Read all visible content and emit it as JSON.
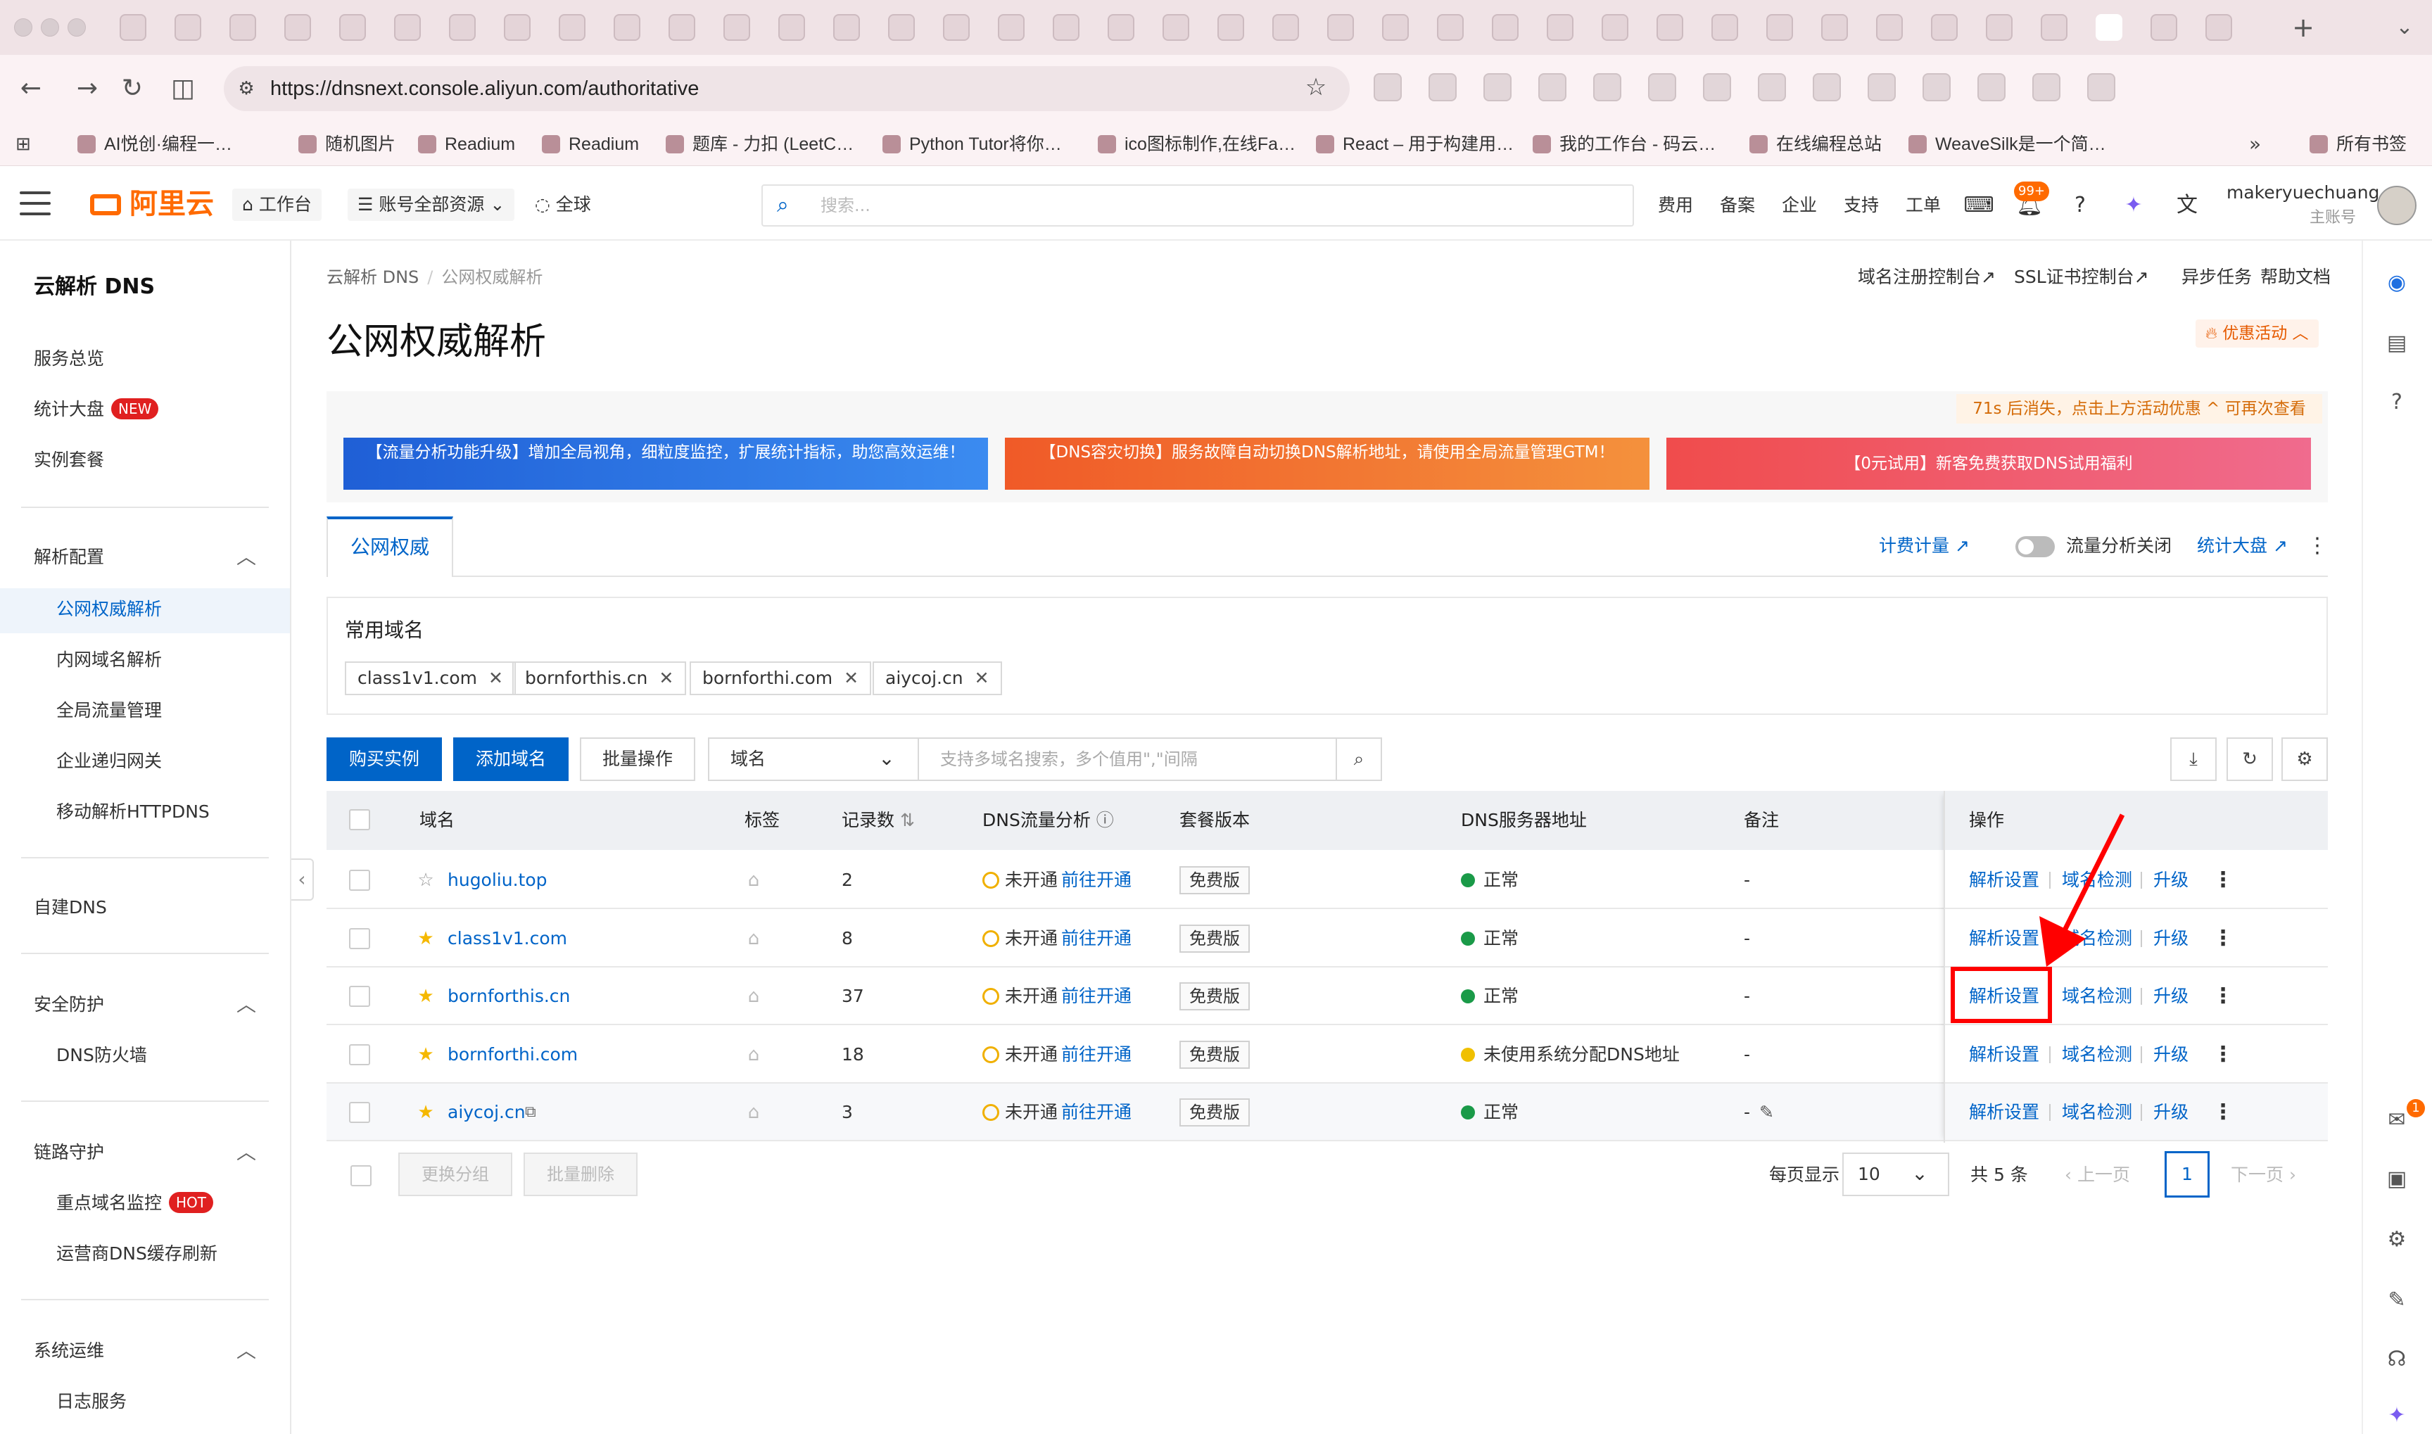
{
  "browser": {
    "url": "https://dnsnext.console.aliyun.com/authoritative",
    "bookmarks": [
      "AI悦创·编程一…",
      "随机图片",
      "Readium",
      "Readium",
      "题库 - 力扣 (LeetC…",
      "Python Tutor将你…",
      "ico图标制作,在线Fa…",
      "React – 用于构建用…",
      "我的工作台 - 码云…",
      "在线编程总站",
      "WeaveSilk是一个简…",
      "所有书签"
    ]
  },
  "topbar": {
    "logo": "阿里云",
    "workbench": "工作台",
    "resources": "账号全部资源",
    "region": "全球",
    "search_placeholder": "搜索...",
    "nav": [
      "费用",
      "备案",
      "企业",
      "支持",
      "工单"
    ],
    "notification_badge": "99+",
    "username": "makeryuechuang",
    "user_role": "主账号"
  },
  "sidebar": {
    "title": "云解析 DNS",
    "items": {
      "overview": "服务总览",
      "dashboard": "统计大盘",
      "dashboard_badge": "NEW",
      "instances": "实例套餐",
      "config_group": "解析配置",
      "authoritative": "公网权威解析",
      "intranet": "内网域名解析",
      "gtm": "全局流量管理",
      "recursive": "企业递归网关",
      "httpdns": "移动解析HTTPDNS",
      "self_dns": "自建DNS",
      "security_group": "安全防护",
      "firewall": "DNS防火墙",
      "link_group": "链路守护",
      "monitor": "重点域名监控",
      "monitor_badge": "HOT",
      "cache_refresh": "运营商DNS缓存刷新",
      "ops_group": "系统运维",
      "logs": "日志服务"
    }
  },
  "main": {
    "breadcrumb": [
      "云解析 DNS",
      "公网权威解析"
    ],
    "title": "公网权威解析",
    "top_links": [
      "域名注册控制台",
      "SSL证书控制台",
      "异步任务",
      "帮助文档"
    ],
    "promo": "优惠活动",
    "banner_tip": "71s 后消失，点击上方活动优惠 ^ 可再次查看",
    "banners": [
      "【流量分析功能升级】增加全局视角，细粒度监控，扩展统计指标，助您高效运维！",
      "【DNS容灾切换】服务故障自动切换DNS解析地址，请使用全局流量管理GTM！",
      "【0元试用】新客免费获取DNS试用福利"
    ],
    "tab": "公网权威",
    "tab_links": {
      "billing": "计费计量",
      "traffic_toggle": "流量分析关闭",
      "stats": "统计大盘"
    },
    "common_domains": {
      "title": "常用域名",
      "chips": [
        "class1v1.com",
        "bornforthis.cn",
        "bornforthi.com",
        "aiycoj.cn"
      ]
    },
    "actions": {
      "buy": "购买实例",
      "add": "添加域名",
      "batch": "批量操作",
      "filter_field": "域名",
      "filter_placeholder": "支持多域名搜索，多个值用\",\"间隔"
    },
    "table": {
      "headers": [
        "域名",
        "标签",
        "记录数",
        "DNS流量分析",
        "套餐版本",
        "DNS服务器地址",
        "备注",
        "操作"
      ],
      "rows": [
        {
          "domain": "hugoliu.top",
          "starred": false,
          "records": "2",
          "traffic": "未开通",
          "traffic_link": "前往开通",
          "plan": "免费版",
          "dns_status": "正常",
          "dns_ok": true,
          "note": "-",
          "ops": [
            "解析设置",
            "域名检测",
            "升级"
          ]
        },
        {
          "domain": "class1v1.com",
          "starred": true,
          "records": "8",
          "traffic": "未开通",
          "traffic_link": "前往开通",
          "plan": "免费版",
          "dns_status": "正常",
          "dns_ok": true,
          "note": "-",
          "ops": [
            "解析设置",
            "域名检测",
            "升级"
          ]
        },
        {
          "domain": "bornforthis.cn",
          "starred": true,
          "records": "37",
          "traffic": "未开通",
          "traffic_link": "前往开通",
          "plan": "免费版",
          "dns_status": "正常",
          "dns_ok": true,
          "note": "-",
          "ops": [
            "解析设置",
            "域名检测",
            "升级"
          ]
        },
        {
          "domain": "bornforthi.com",
          "starred": true,
          "records": "18",
          "traffic": "未开通",
          "traffic_link": "前往开通",
          "plan": "免费版",
          "dns_status": "未使用系统分配DNS地址",
          "dns_ok": false,
          "note": "-",
          "ops": [
            "解析设置",
            "域名检测",
            "升级"
          ]
        },
        {
          "domain": "aiycoj.cn",
          "starred": true,
          "records": "3",
          "traffic": "未开通",
          "traffic_link": "前往开通",
          "plan": "免费版",
          "dns_status": "正常",
          "dns_ok": true,
          "note": "-",
          "ops": [
            "解析设置",
            "域名检测",
            "升级"
          ]
        }
      ]
    },
    "footer": {
      "change_group": "更换分组",
      "batch_delete": "批量删除",
      "page_size_label": "每页显示",
      "page_size": "10",
      "total": "共 5 条",
      "prev": "上一页",
      "current_page": "1",
      "next": "下一页"
    }
  },
  "colors": {
    "primary": "#0064c8",
    "brand": "#ff6a00",
    "highlight": "#ff0000",
    "ok": "#1a9a48",
    "warn": "#f0c000"
  }
}
